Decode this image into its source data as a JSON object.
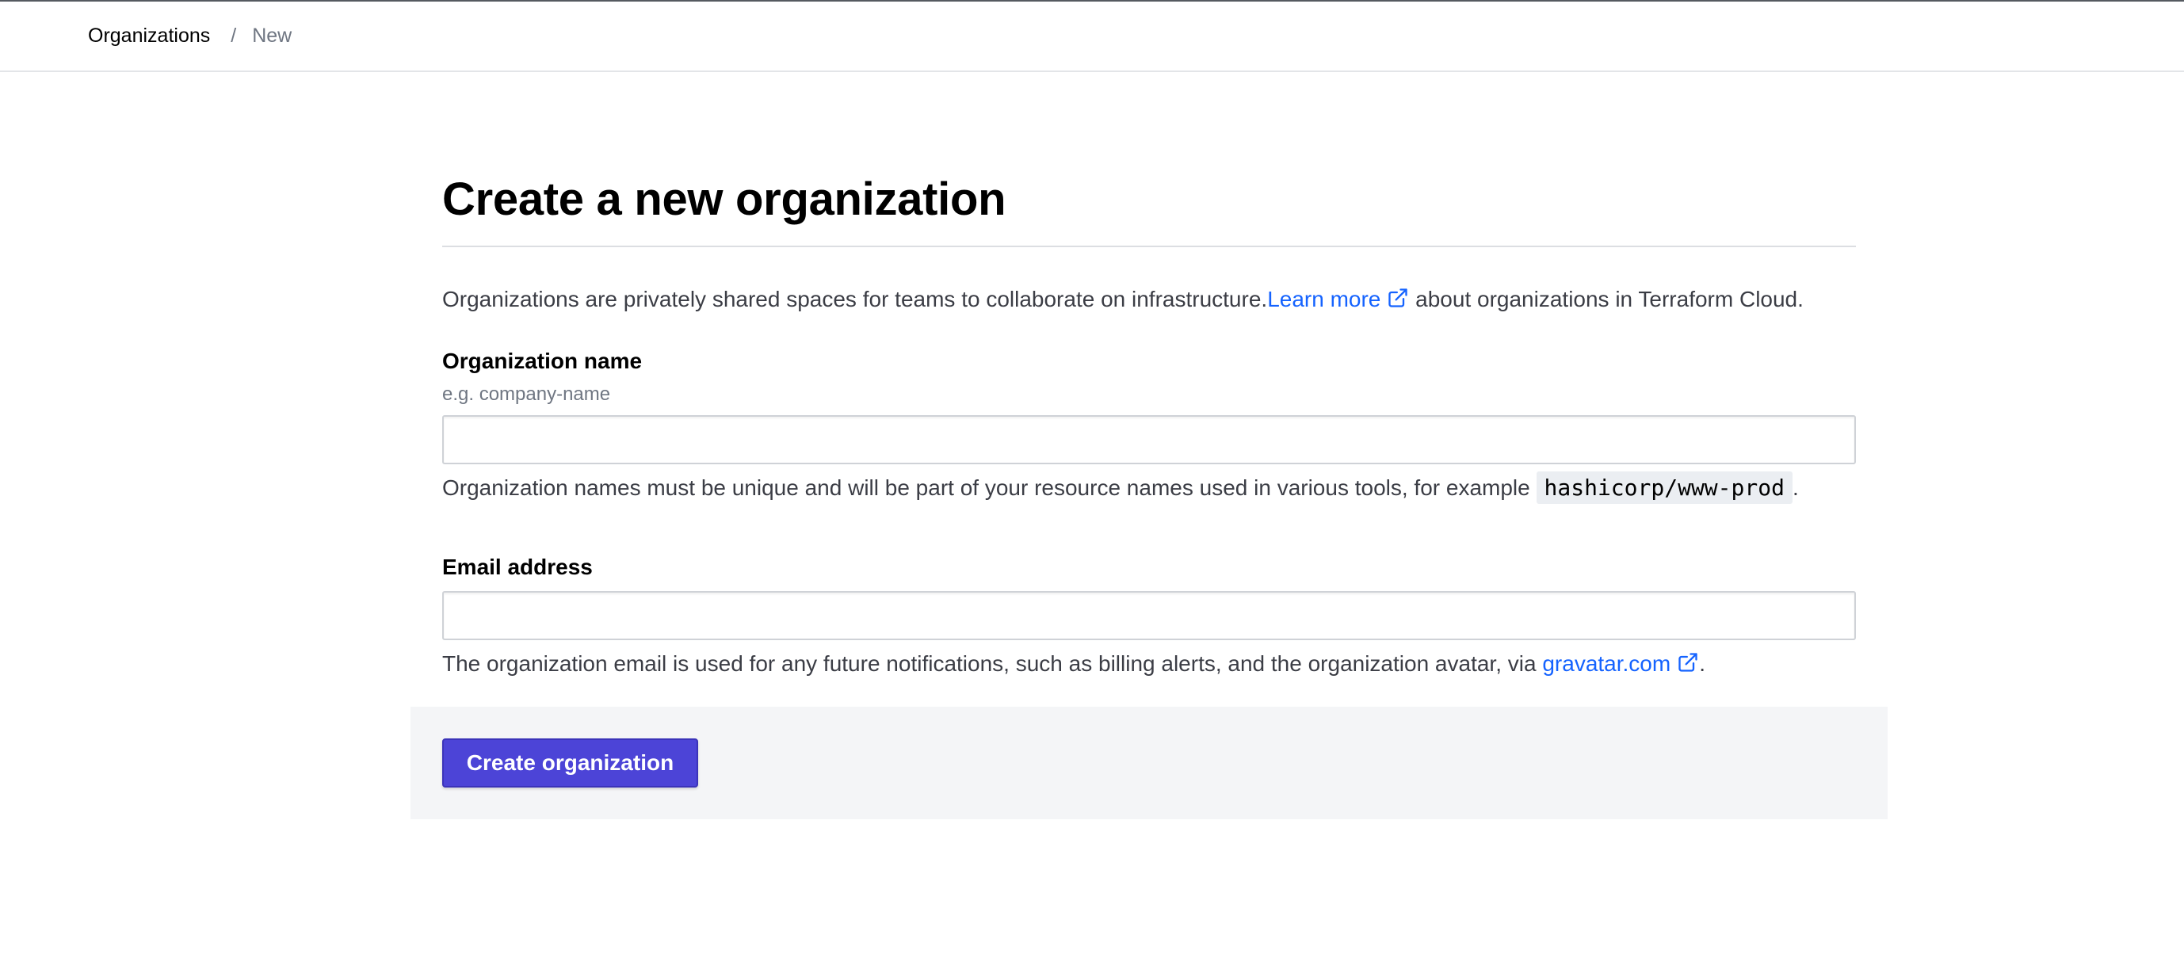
{
  "breadcrumb": {
    "parent": "Organizations",
    "separator": "/",
    "current": "New"
  },
  "page": {
    "title": "Create a new organization",
    "intro_before": "Organizations are privately shared spaces for teams to collaborate on infrastructure.",
    "intro_link": "Learn more",
    "intro_after": " about organizations in Terraform Cloud."
  },
  "form": {
    "org_name": {
      "label": "Organization name",
      "hint": "e.g. company-name",
      "value": "",
      "help_before": "Organization names must be unique and will be part of your resource names used in various tools, for example ",
      "help_code": "hashicorp/www-prod",
      "help_after": "."
    },
    "email": {
      "label": "Email address",
      "value": "",
      "help_before": "The organization email is used for any future notifications, such as billing alerts, and the organization avatar, via ",
      "help_link": "gravatar.com",
      "help_after": "."
    },
    "submit_label": "Create organization"
  },
  "icons": {
    "external_link": "external-link-icon"
  },
  "colors": {
    "link": "#1563ff",
    "primary_button": "#4c44d7",
    "action_bar": "#f4f5f7"
  }
}
